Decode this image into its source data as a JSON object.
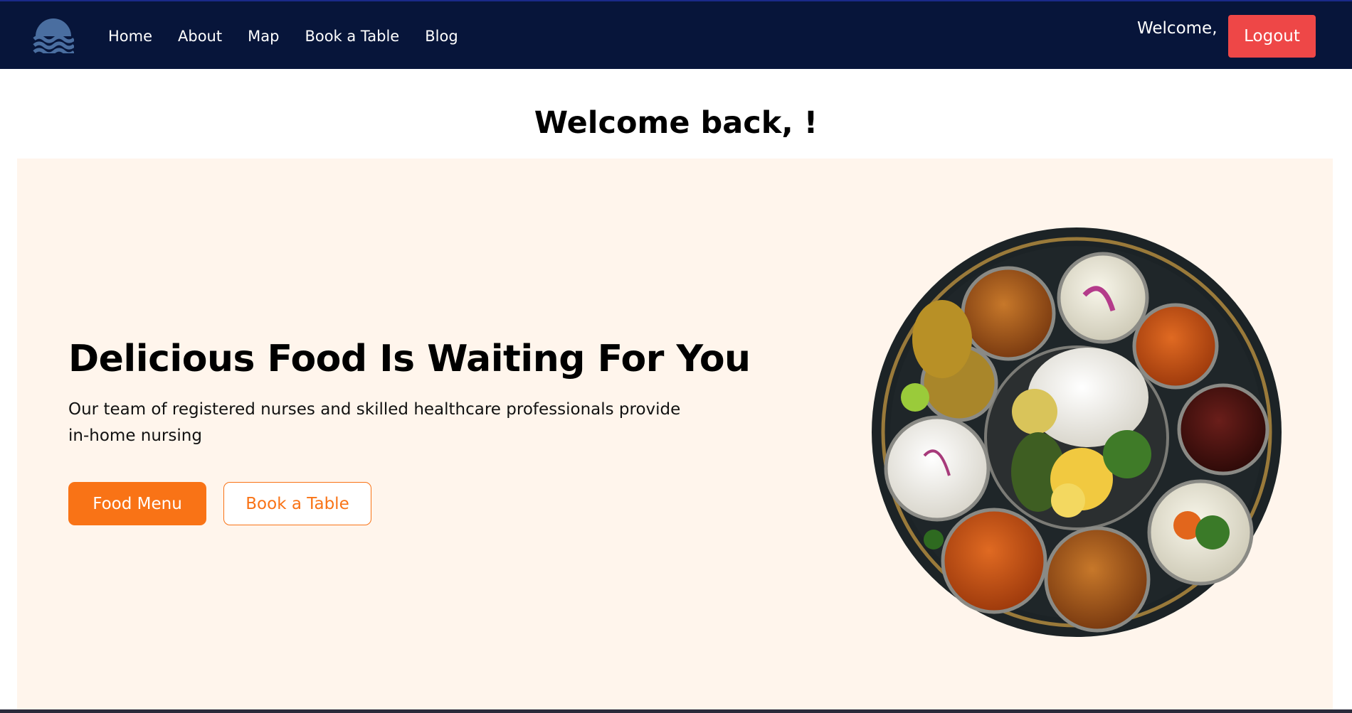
{
  "nav": {
    "links": [
      "Home",
      "About",
      "Map",
      "Book a Table",
      "Blog"
    ],
    "welcome_text": "Welcome,",
    "logout_label": "Logout"
  },
  "page": {
    "title": "Welcome back, !"
  },
  "hero": {
    "heading": "Delicious Food Is Waiting For You",
    "text": "Our team of registered nurses and skilled healthcare professionals provide in-home nursing",
    "food_menu_label": "Food Menu",
    "book_table_label": "Book a Table"
  },
  "colors": {
    "navbar": "#07153a",
    "logout": "#ee4747",
    "accent": "#f97316",
    "hero_bg": "#fff5ec"
  },
  "icons": {
    "logo": "wave-sun-logo-icon"
  }
}
